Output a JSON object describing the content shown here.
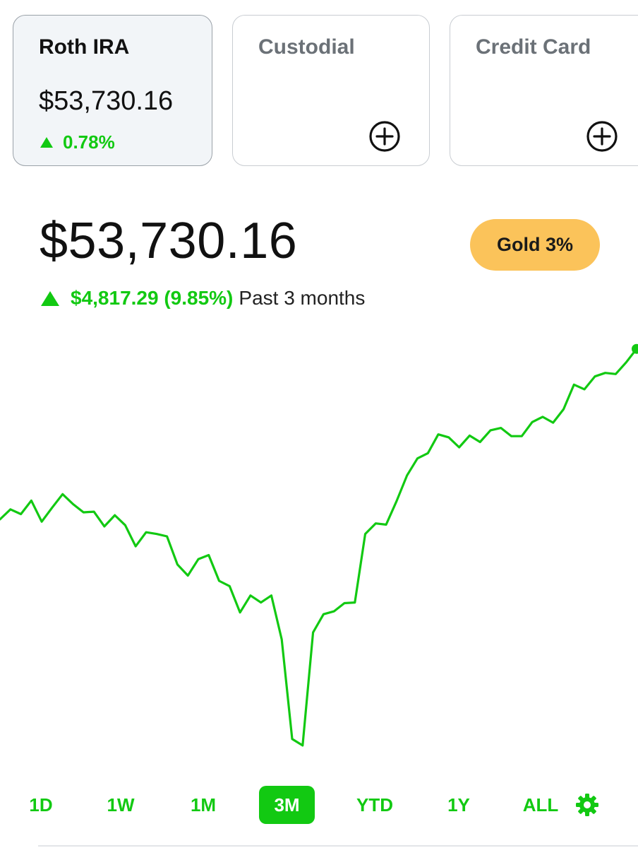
{
  "accounts": [
    {
      "title": "Roth IRA",
      "value": "$53,730.16",
      "change": "0.78%",
      "active": true
    },
    {
      "title": "Custodial",
      "action_icon": "plus-circle-icon"
    },
    {
      "title": "Credit Card",
      "action_icon": "plus-circle-icon"
    }
  ],
  "portfolio": {
    "value": "$53,730.16",
    "change_amount": "$4,817.29 (9.85%)",
    "change_period": "Past 3 months",
    "badge": "Gold 3%"
  },
  "ranges": [
    "1D",
    "1W",
    "1M",
    "3M",
    "YTD",
    "1Y",
    "ALL"
  ],
  "selected_range": "3M",
  "colors": {
    "accent_green": "#12c912",
    "gold": "#fbc35a",
    "card_border": "#c9cdd2",
    "active_card_bg": "#f2f5f8"
  },
  "chart_data": {
    "type": "line",
    "title": "",
    "xlabel": "",
    "ylabel": "",
    "grid": false,
    "legend": "none",
    "ylim": [
      47000,
      54600
    ],
    "series": [
      {
        "values": [
          51380,
          51550,
          51470,
          51700,
          51340,
          51580,
          51810,
          51640,
          51500,
          51510,
          51260,
          51450,
          51280,
          50920,
          51160,
          51130,
          51090,
          50610,
          50420,
          50700,
          50770,
          50330,
          50240,
          49790,
          50080,
          49960,
          50080,
          49330,
          47630,
          47520,
          49450,
          49760,
          49810,
          49950,
          49960,
          51130,
          51310,
          51290,
          51690,
          52130,
          52420,
          52510,
          52830,
          52780,
          52610,
          52810,
          52700,
          52900,
          52940,
          52800,
          52800,
          53040,
          53130,
          53030,
          53260,
          53680,
          53600,
          53820,
          53880,
          53860,
          54060,
          54290
        ]
      }
    ]
  }
}
